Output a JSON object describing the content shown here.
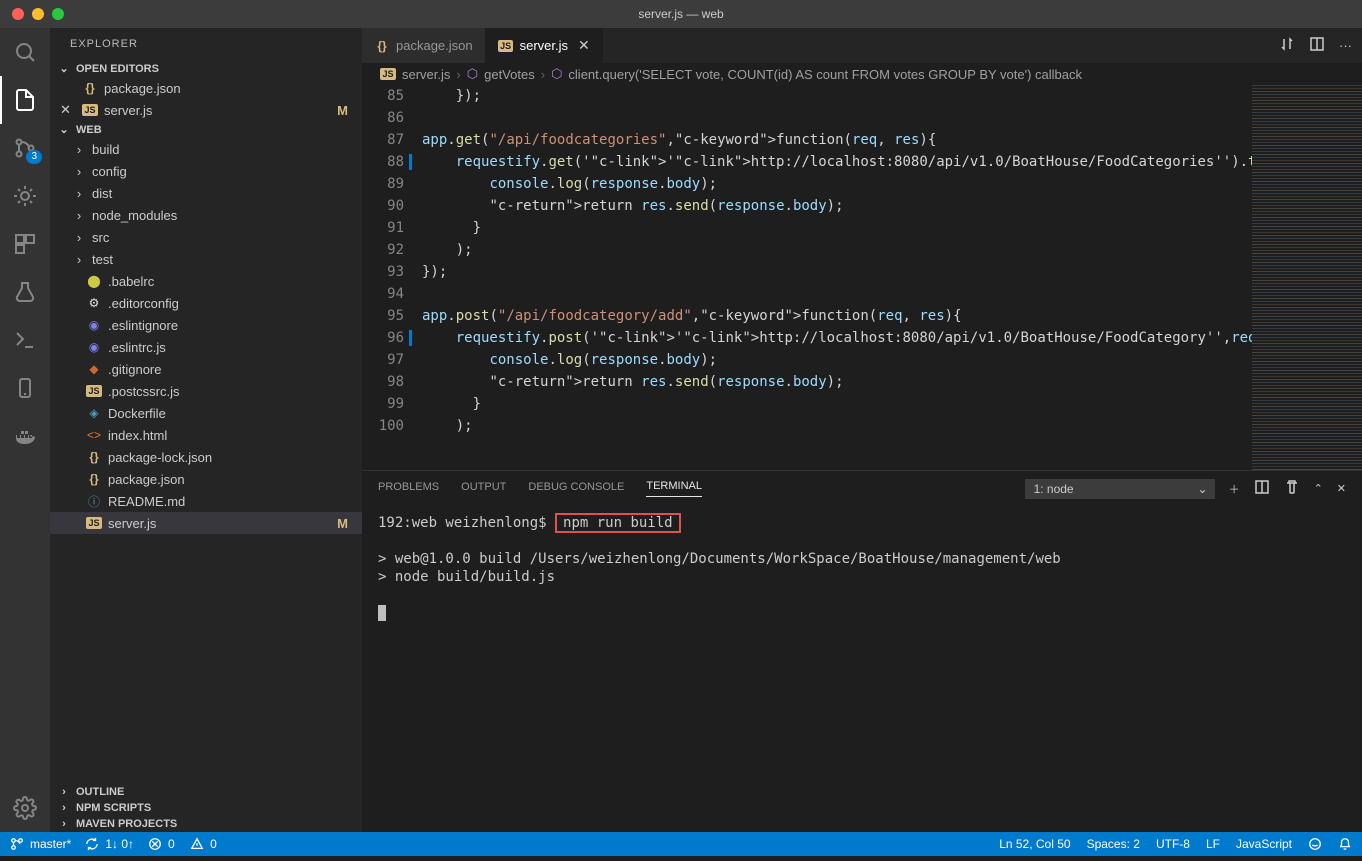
{
  "window": {
    "title": "server.js — web"
  },
  "explorer": {
    "title": "EXPLORER",
    "open_editors": "OPEN EDITORS",
    "open_files": [
      {
        "name": "package.json",
        "icon": "braces"
      },
      {
        "name": "server.js",
        "icon": "js",
        "modified": "M",
        "open": true
      }
    ],
    "workspace": "WEB",
    "tree": [
      {
        "name": "build",
        "type": "folder"
      },
      {
        "name": "config",
        "type": "folder"
      },
      {
        "name": "dist",
        "type": "folder"
      },
      {
        "name": "node_modules",
        "type": "folder"
      },
      {
        "name": "src",
        "type": "folder"
      },
      {
        "name": "test",
        "type": "folder"
      },
      {
        "name": ".babelrc",
        "type": "file",
        "icon": "babel"
      },
      {
        "name": ".editorconfig",
        "type": "file",
        "icon": "editorconfig"
      },
      {
        "name": ".eslintignore",
        "type": "file",
        "icon": "eslint"
      },
      {
        "name": ".eslintrc.js",
        "type": "file",
        "icon": "eslint"
      },
      {
        "name": ".gitignore",
        "type": "file",
        "icon": "git"
      },
      {
        "name": ".postcssrc.js",
        "type": "file",
        "icon": "js"
      },
      {
        "name": "Dockerfile",
        "type": "file",
        "icon": "docker"
      },
      {
        "name": "index.html",
        "type": "file",
        "icon": "html"
      },
      {
        "name": "package-lock.json",
        "type": "file",
        "icon": "braces"
      },
      {
        "name": "package.json",
        "type": "file",
        "icon": "braces"
      },
      {
        "name": "README.md",
        "type": "file",
        "icon": "info"
      },
      {
        "name": "server.js",
        "type": "file",
        "icon": "js",
        "modified": "M",
        "active": true
      }
    ],
    "outline": "OUTLINE",
    "npm": "NPM SCRIPTS",
    "maven": "MAVEN PROJECTS"
  },
  "scm_badge": "3",
  "tabs": [
    {
      "label": "package.json",
      "icon": "braces"
    },
    {
      "label": "server.js",
      "icon": "js",
      "active": true,
      "closable": true
    }
  ],
  "breadcrumb": {
    "file": "server.js",
    "func": "getVotes",
    "detail": "client.query('SELECT vote, COUNT(id) AS count FROM votes GROUP BY vote') callback"
  },
  "code": {
    "start": 85,
    "lines": [
      "    });",
      "",
      "app.get(\"/api/foodcategories\",function(req, res){",
      "    requestify.get('http://localhost:8080/api/v1.0/BoatHouse/FoodCategories').then(function(res",
      "        console.log(response.body);",
      "        return res.send(response.body);",
      "      }",
      "    );",
      "});",
      "",
      "app.post(\"/api/foodcategory/add\",function(req, res){",
      "    requestify.post('http://localhost:8080/api/v1.0/BoatHouse/FoodCategory',req.body).then(func",
      "        console.log(response.body);",
      "        return res.send(response.body);",
      "      }",
      "    );"
    ],
    "breakpoint_at": 88,
    "blue_decor": [
      88,
      96
    ]
  },
  "panel": {
    "tabs": {
      "problems": "PROBLEMS",
      "output": "OUTPUT",
      "debug": "DEBUG CONSOLE",
      "terminal": "TERMINAL"
    },
    "term_select": "1: node",
    "prompt": "192:web weizhenlong$",
    "command": "npm run build",
    "output1": "> web@1.0.0 build /Users/weizhenlong/Documents/WorkSpace/BoatHouse/management/web",
    "output2": "> node build/build.js"
  },
  "status": {
    "branch": "master*",
    "sync": "1↓ 0↑",
    "errors": "0",
    "warnings": "0",
    "ln_col": "Ln 52, Col 50",
    "spaces": "Spaces: 2",
    "encoding": "UTF-8",
    "eol": "LF",
    "lang": "JavaScript"
  }
}
